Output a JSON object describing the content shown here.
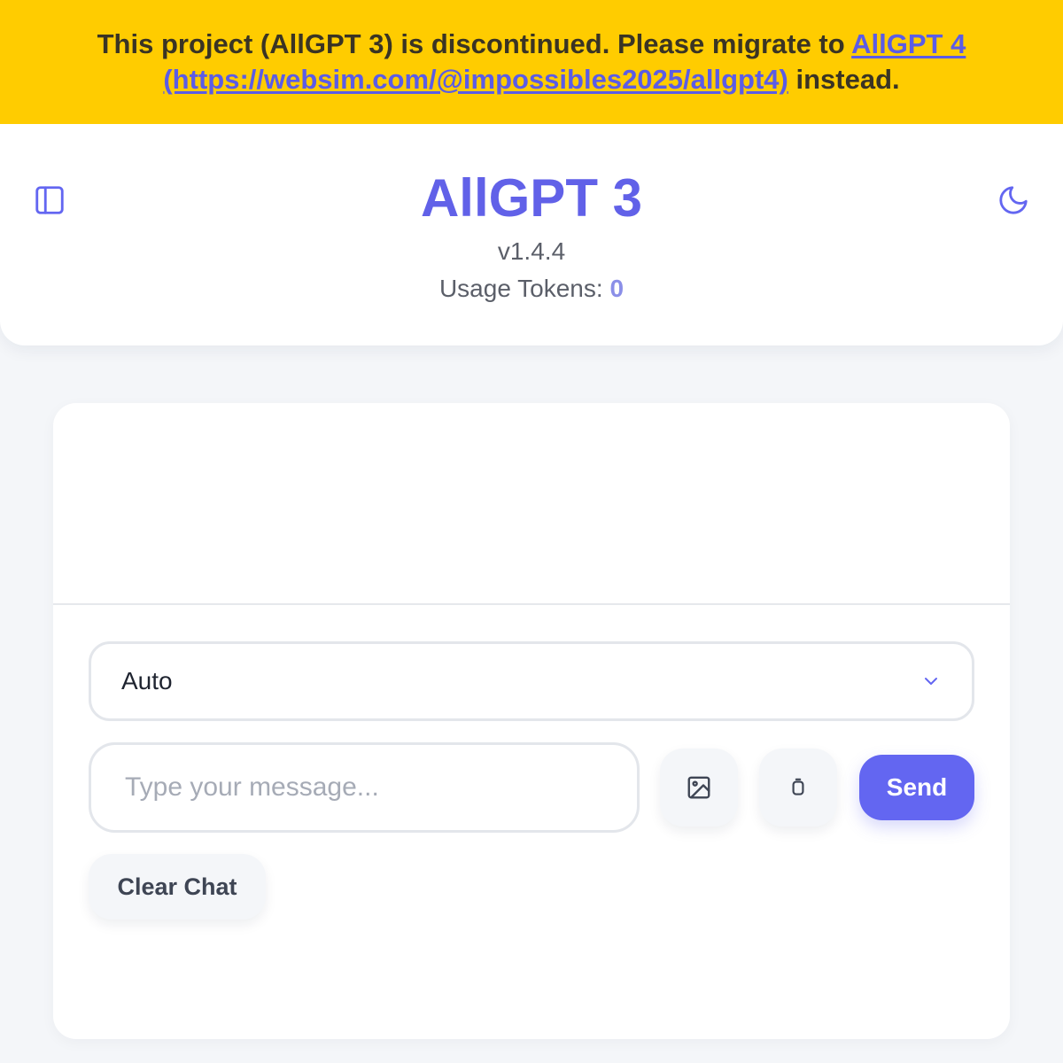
{
  "banner": {
    "text_before": "This project (AllGPT 3) is discontinued. Please migrate to ",
    "link_text": "AllGPT 4 (https://websim.com/@impossibles2025/allgpt4)",
    "text_after": " instead."
  },
  "header": {
    "title": "AllGPT 3",
    "version": "v1.4.4",
    "usage_label": "Usage Tokens: ",
    "usage_count": "0",
    "sidebar_icon": "sidebar-panel-icon",
    "theme_icon": "moon-icon"
  },
  "composer": {
    "model_selected": "Auto",
    "message_placeholder": "Type your message...",
    "message_value": "",
    "image_icon": "image-icon",
    "voice_icon": "voice-icon",
    "send_label": "Send",
    "clear_label": "Clear Chat"
  },
  "colors": {
    "banner_bg": "#ffcc00",
    "accent": "#6366f1",
    "title": "#6161e8",
    "background": "#f4f6f9"
  }
}
